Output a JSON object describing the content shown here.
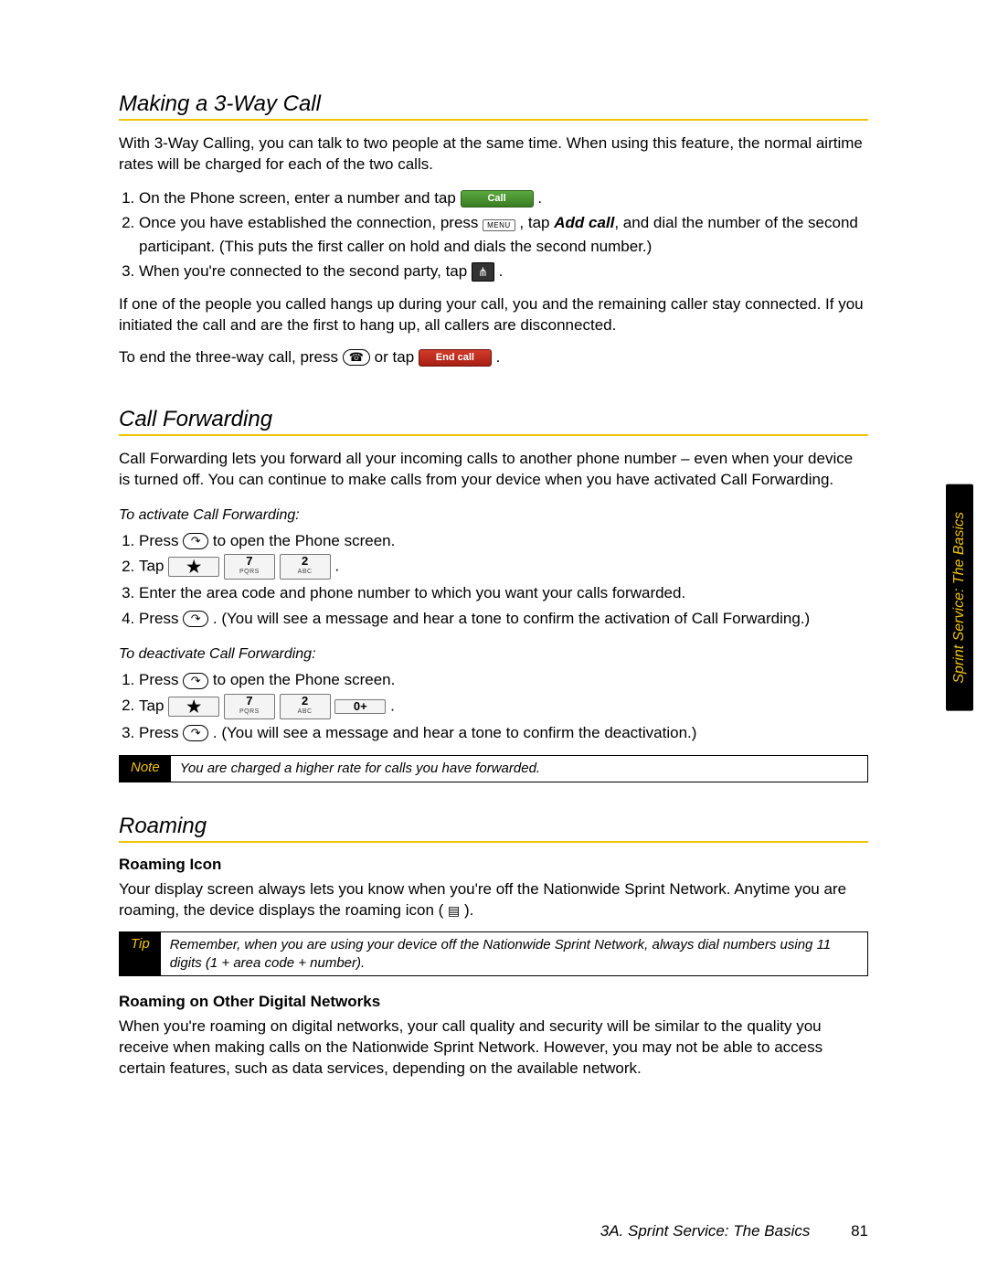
{
  "sections": {
    "threeway": {
      "title": "Making a 3-Way Call",
      "intro": "With 3-Way Calling, you can talk to two people at the same time. When using this feature, the normal airtime rates will be charged for each of the two calls.",
      "step1a": "On the Phone screen, enter a number and tap ",
      "callBtn": "Call",
      "step1b": " .",
      "step2a": "Once you have established the connection, press ",
      "menuBtn": "menu",
      "step2b": " , tap ",
      "addcall": "Add call",
      "step2c": ", and dial the number of the second participant. (This puts the first caller on hold and dials the second number.)",
      "step3a": "When you're connected to the second party, tap ",
      "mergeIcon": "⋔",
      "step3b": " .",
      "outro1": "If one of the people you called hangs up during your call, you and the remaining caller stay connected. If you initiated the call and are the first to hang up, all callers are disconnected.",
      "endA": "To end the three-way call, press ",
      "endKey": "☎",
      "endB": " or tap ",
      "endCallBtn": "End call",
      "endC": " ."
    },
    "forwarding": {
      "title": "Call Forwarding",
      "intro": "Call Forwarding lets you forward all your incoming calls to another phone number – even when your device is turned off. You can continue to make calls from your device when you have activated Call Forwarding.",
      "activateHeading": "To activate Call Forwarding:",
      "a1a": "Press ",
      "phoneKey": "↷",
      "a1b": " to open the Phone screen.",
      "a2": "Tap ",
      "keyStar": "★",
      "key7main": "7",
      "key7sub": "PQRS",
      "key2main": "2",
      "key2sub": "ABC",
      "key0": "0+",
      "a2b": " .",
      "a3": "Enter the area code and phone number to which you want your calls forwarded.",
      "a4a": "Press ",
      "a4b": ". (You will see a message and hear a tone to confirm the activation of Call Forwarding.)",
      "deactivateHeading": "To deactivate Call Forwarding:",
      "d3a": "Press ",
      "d3b": ". (You will see a message and hear a tone to confirm the deactivation.)",
      "noteLabel": "Note",
      "noteText": "You are charged a higher rate for calls you have forwarded."
    },
    "roaming": {
      "title": "Roaming",
      "iconHeading": "Roaming Icon",
      "iconTextA": "Your display screen always lets you know when you're off the Nationwide Sprint Network. Anytime you are roaming, the device displays the roaming icon ( ",
      "roamIcon": "▤",
      "iconTextB": " ).",
      "tipLabel": "Tip",
      "tipText": "Remember, when you are using your device off the Nationwide Sprint Network, always dial numbers using 11 digits (1 + area code + number).",
      "otherHeading": "Roaming on Other Digital Networks",
      "otherText": "When you're roaming on digital networks, your call quality and security will be similar to the quality you receive when making calls on the Nationwide Sprint Network. However, you may not be able to access certain features, such as data services, depending on the available network."
    }
  },
  "sideTab": "Sprint Service: The Basics",
  "footer": {
    "chapter": "3A. Sprint Service: The Basics",
    "page": "81"
  }
}
